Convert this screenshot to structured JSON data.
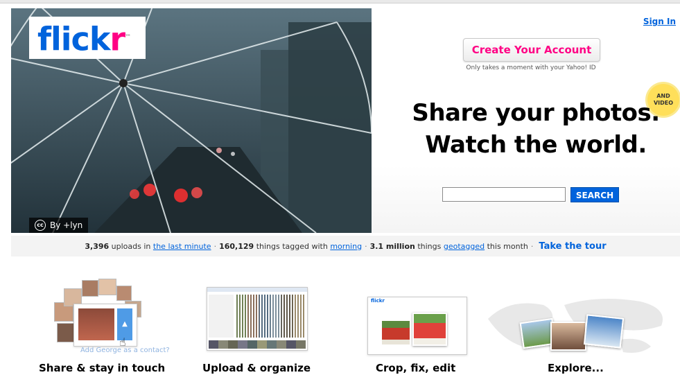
{
  "logo": {
    "part1": "flick",
    "part2": "r",
    "tm": "™"
  },
  "credit": {
    "cc": "cc",
    "text": "By +lyn"
  },
  "header": {
    "sign_in": "Sign In"
  },
  "cta": {
    "create_account": "Create Your Account",
    "subtitle": "Only takes a moment with your Yahoo! ID"
  },
  "badge": {
    "line1": "AND",
    "line2": "VIDEO"
  },
  "headline": {
    "line1": "Share your photos.",
    "line2": "Watch the world."
  },
  "search": {
    "value": "",
    "button": "SEARCH"
  },
  "stats": {
    "uploads_count": "3,396",
    "uploads_text": "uploads in",
    "uploads_link": "the last minute",
    "tagged_count": "160,129",
    "tagged_text": "things tagged with",
    "tagged_link": "morning",
    "geo_count": "3.1 million",
    "geo_text": "things",
    "geo_link": "geotagged",
    "geo_suffix": "this month",
    "tour": "Take the tour"
  },
  "features": {
    "share": {
      "label": "Share & stay in touch",
      "hint": "Add George as a contact?"
    },
    "upload": {
      "label": "Upload & organize"
    },
    "crop": {
      "label": "Crop, fix, edit",
      "mini_logo": "flickr"
    },
    "explore": {
      "label": "Explore..."
    }
  },
  "colors": {
    "flickr_blue": "#0063dc",
    "flickr_pink": "#ff0084",
    "badge_yellow": "#ffdf5a"
  }
}
